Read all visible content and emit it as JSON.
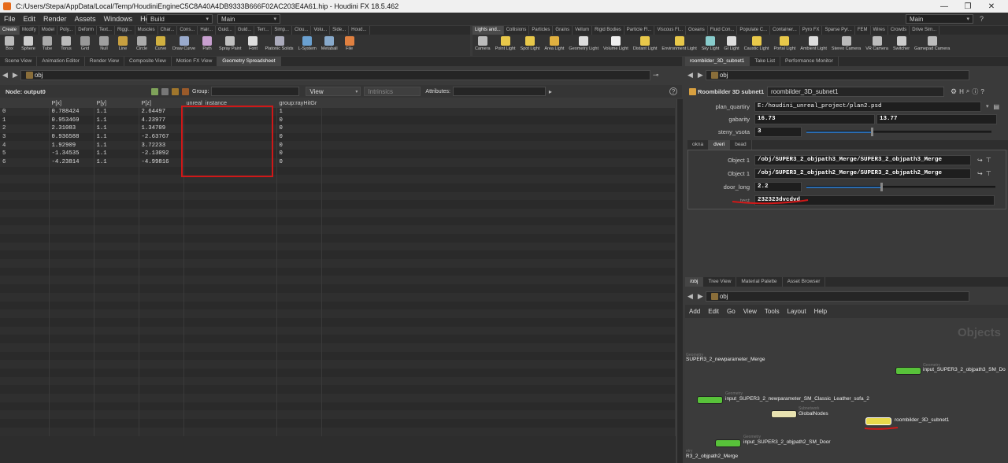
{
  "window": {
    "title": "C:/Users/Stepa/AppData/Local/Temp/HoudiniEngineC5C8A40A4DB9333B666F02AC203E4A61.hip - Houdini FX 18.5.462",
    "minimize": "—",
    "maximize": "❐",
    "close": "✕"
  },
  "menubar": {
    "items": [
      "File",
      "Edit",
      "Render",
      "Assets",
      "Windows",
      "Help"
    ],
    "build": "Build",
    "desktop_left": "Main",
    "desktop_right": "Main"
  },
  "shelf_tabs_left": [
    "Create",
    "Modify",
    "Model",
    "Poly...",
    "Deform",
    "Text...",
    "Riggi...",
    "Muscles",
    "Char...",
    "Cons...",
    "Hair...",
    "Guid...",
    "Guid...",
    "Terr...",
    "Simp...",
    "Clou...",
    "Volu...",
    "Side...",
    "Houd..."
  ],
  "shelf_tabs_right": [
    "Lights and...",
    "Collisions",
    "Particles",
    "Grains",
    "Vellum",
    "Rigid Bodies",
    "Particle Fl...",
    "Viscous Fl...",
    "Oceans",
    "Fluid Con...",
    "Populate C...",
    "Container...",
    "Pyro FX",
    "Sparse Pyr...",
    "FEM",
    "Wires",
    "Crowds",
    "Drive Sim..."
  ],
  "shelf_tools_left": [
    "Box",
    "Sphere",
    "Tube",
    "Torus",
    "Grid",
    "Null",
    "Line",
    "Circle",
    "Curve",
    "Draw Curve",
    "Path",
    "Spray Paint",
    "Font",
    "Platonic Solids",
    "L-System",
    "Metaball",
    "File"
  ],
  "shelf_tools_right": [
    "Camera",
    "Point Light",
    "Spot Light",
    "Area Light",
    "Geometry Light",
    "Volume Light",
    "Distant Light",
    "Environment Light",
    "Sky Light",
    "GI Light",
    "Caustic Light",
    "Portal Light",
    "Ambient Light",
    "Stereo Camera",
    "VR Camera",
    "Switcher",
    "Gamepad Camera"
  ],
  "left_pane_tabs": [
    "Scene View",
    "Animation Editor",
    "Render View",
    "Composite View",
    "Motion FX View",
    "Geometry Spreadsheet"
  ],
  "left_path": "obj",
  "spreadsheet": {
    "node": "Node: output0",
    "group_label": "Group:",
    "view_label": "View",
    "intrinsics_label": "Intrinsics",
    "attributes_label": "Attributes:",
    "columns": [
      "",
      "P[x]",
      "P[y]",
      "P[z]",
      "unreal_instance",
      "group:rayHitGr"
    ],
    "rows": [
      [
        "0",
        "0.788424",
        "1.1",
        "2.64497",
        "",
        "1"
      ],
      [
        "1",
        "0.953469",
        "1.1",
        "4.23977",
        "",
        "0"
      ],
      [
        "2",
        "2.31083",
        "1.1",
        "1.34709",
        "",
        "0"
      ],
      [
        "3",
        "0.936588",
        "1.1",
        "-2.63767",
        "",
        "0"
      ],
      [
        "4",
        "1.92909",
        "1.1",
        "3.72233",
        "",
        "0"
      ],
      [
        "5",
        "-1.34535",
        "1.1",
        "-2.13092",
        "",
        "0"
      ],
      [
        "6",
        "-4.23814",
        "1.1",
        "-4.99816",
        "",
        "0"
      ]
    ],
    "empty_rows": 32
  },
  "right_top_tabs": [
    "roombilder_3D_subnet1",
    "Take List",
    "Performance Monitor"
  ],
  "right_path": "obj",
  "params": {
    "node_type": "Roombilder 3D subnet1",
    "node_name": "roombilder_3D_subnet1",
    "plan_quartiry_label": "plan_quartiry",
    "plan_quartiry": "E:/houdini_unreal_project/plan2.psd",
    "gabarity_label": "gabarity",
    "gabarity_x": "16.73",
    "gabarity_y": "13.77",
    "steny_label": "steny_vsota",
    "steny": "3",
    "folders": [
      "okna",
      "dveri",
      "bead"
    ],
    "object1_label": "Object 1",
    "object1_a": "/obj/SUPER3_2_objpath3_Merge/SUPER3_2_objpath3_Merge",
    "object1_b": "/obj/SUPER3_2_objpath2_Merge/SUPER3_2_objpath2_Merge",
    "door_long_label": "door_long",
    "door_long": "2.2",
    "test_label": "test",
    "test": "232323dvcdvd"
  },
  "network_tabs": [
    "/obj",
    "Tree View",
    "Material Palette",
    "Asset Browser"
  ],
  "network_path": "obj",
  "network_menu": [
    "Add",
    "Edit",
    "Go",
    "View",
    "Tools",
    "Layout",
    "Help"
  ],
  "network_title": "Objects",
  "nodes": [
    {
      "type": "Geometry",
      "label": "SUPER3_2_newparameter_Merge"
    },
    {
      "type": "Geometry",
      "label": "input_SUPER3_2_objpath3_SM_Do"
    },
    {
      "type": "Geometry",
      "label": "input_SUPER3_2_newparameter_SM_Classic_Leather_sofa_2"
    },
    {
      "type": "Subnetwork",
      "label": "GlobalNodes"
    },
    {
      "type": "",
      "label": "roombilder_3D_subnet1"
    },
    {
      "type": "Geometry",
      "label": "input_SUPER3_2_objpath2_SM_Door"
    },
    {
      "type": "etry",
      "label": "R3_2_objpath2_Merge"
    }
  ],
  "colors": {
    "accent_red": "#d01818",
    "node_green": "#58c23a",
    "node_yellow": "#e8d84a",
    "slider_blue": "#2b6cb0"
  }
}
